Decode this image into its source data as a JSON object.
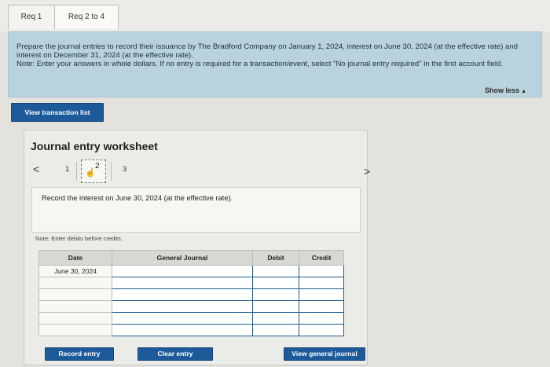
{
  "tabs": [
    {
      "label": "Req 1"
    },
    {
      "label": "Req 2 to 4"
    }
  ],
  "prompt": {
    "text": "Prepare the journal entries to record their issuance by The Bradford Company on January 1, 2024, interest on June 30, 2024 (at the effective rate) and interest on December 31, 2024 (at the effective rate).",
    "note": "Note: Enter your answers in whole dollars. If no entry is required for a transaction/event, select \"No journal entry required\" in the first account field."
  },
  "show_less": "Show less",
  "view_transaction_list": "View transaction list",
  "worksheet": {
    "title": "Journal entry worksheet",
    "steps": [
      "1",
      "2",
      "3"
    ],
    "instruction": "Record the interest on June 30, 2024 (at the effective rate).",
    "note": "Note: Enter debits before credits.",
    "columns": [
      "Date",
      "General Journal",
      "Debit",
      "Credit"
    ],
    "rows": [
      {
        "date": "June 30, 2024",
        "account": "",
        "debit": "",
        "credit": ""
      },
      {
        "date": "",
        "account": "",
        "debit": "",
        "credit": ""
      },
      {
        "date": "",
        "account": "",
        "debit": "",
        "credit": ""
      },
      {
        "date": "",
        "account": "",
        "debit": "",
        "credit": ""
      },
      {
        "date": "",
        "account": "",
        "debit": "",
        "credit": ""
      },
      {
        "date": "",
        "account": "",
        "debit": "",
        "credit": ""
      }
    ]
  },
  "buttons": {
    "record_entry": "Record entry",
    "clear_entry": "Clear entry",
    "view_general_journal": "View general journal"
  },
  "colors": {
    "button_blue": "#1d5a9a",
    "prompt_background": "#b9d3de",
    "input_border": "#1e5b8d"
  }
}
